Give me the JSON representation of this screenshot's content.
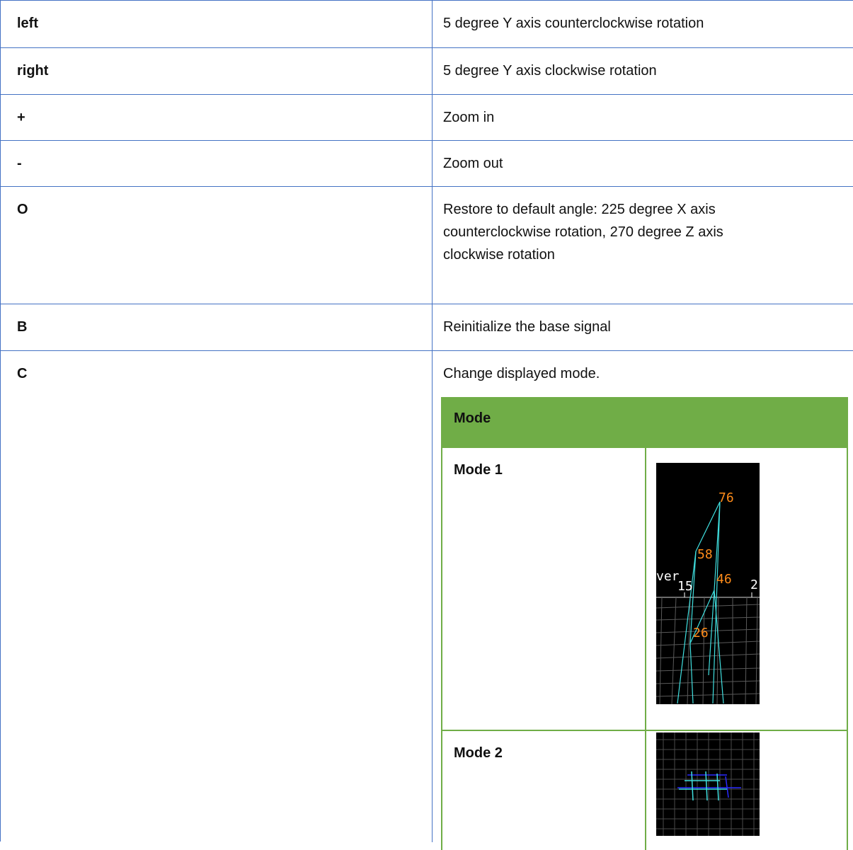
{
  "rows": [
    {
      "key": "left",
      "desc": "5 degree Y axis counterclockwise rotation"
    },
    {
      "key": "right",
      "desc": "5 degree Y axis clockwise rotation"
    },
    {
      "key": "+",
      "desc": "Zoom in"
    },
    {
      "key": "-",
      "desc": "Zoom out"
    },
    {
      "key": "O",
      "desc_lines": [
        "Restore to default angle: 225 degree X axis",
        "counterclockwise rotation, 270 degree Z axis",
        "clockwise rotation"
      ]
    },
    {
      "key": "B",
      "desc": "Reinitialize the base signal"
    },
    {
      "key": "C",
      "desc": "Change displayed mode."
    }
  ],
  "mode_table": {
    "header": "Mode",
    "modes": [
      {
        "label": "Mode 1",
        "labels_in_image": [
          "76",
          "58",
          "46",
          "26",
          "15",
          "ver",
          "2"
        ]
      },
      {
        "label": "Mode 2"
      }
    ]
  },
  "colors": {
    "table_border": "#4472c4",
    "mode_header": "#70ad47",
    "peak_label": "#ff8c1a",
    "line": "#40e0e0"
  }
}
